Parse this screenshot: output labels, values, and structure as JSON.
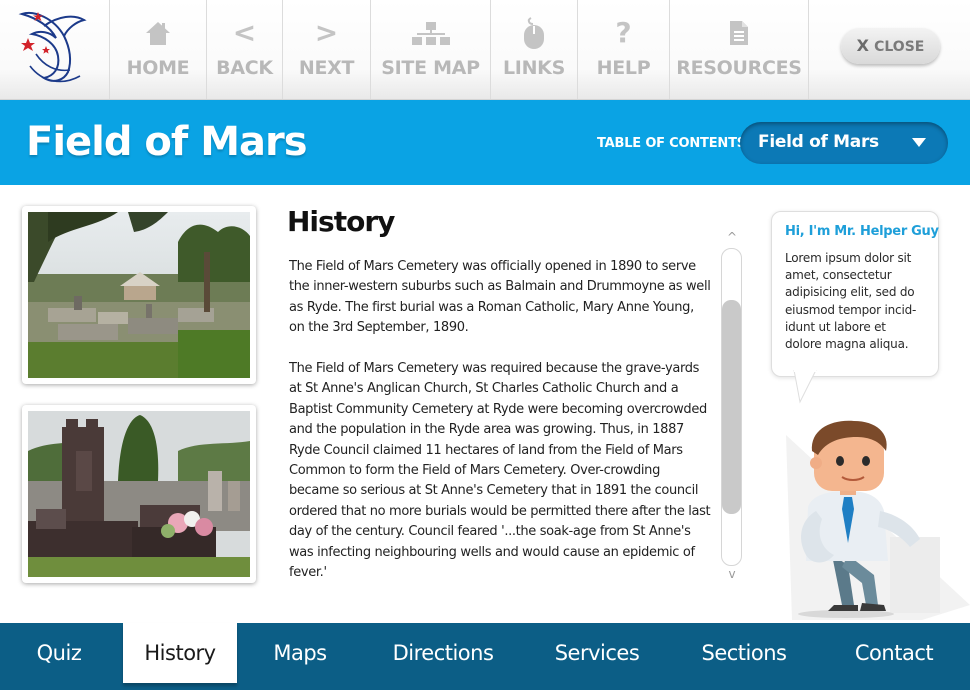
{
  "toolbar": {
    "home": {
      "label": "HOME",
      "icon": "home-icon"
    },
    "back": {
      "label": "BACK",
      "icon": "chevron-left-icon",
      "glyph": "<"
    },
    "next": {
      "label": "NEXT",
      "icon": "chevron-right-icon",
      "glyph": ">"
    },
    "sitemap": {
      "label": "SITE MAP",
      "icon": "sitemap-icon"
    },
    "links": {
      "label": "LINKS",
      "icon": "mouse-icon"
    },
    "help": {
      "label": "HELP",
      "icon": "question-icon",
      "glyph": "?"
    },
    "resources": {
      "label": "RESOURCES",
      "icon": "document-icon"
    },
    "close": {
      "x": "X",
      "label": "CLOSE"
    }
  },
  "header": {
    "title": "Field of Mars",
    "toc_label": "TABLE OF CONTENTS",
    "toc_selected": "Field of Mars"
  },
  "article": {
    "heading": "History",
    "paragraphs": [
      "The Field of Mars Cemetery was officially opened in 1890 to serve the inner-western suburbs such as Balmain and Drummoyne as well as Ryde. The first burial was a Roman Catholic, Mary Anne Young, on the 3rd September, 1890.",
      "The Field of Mars Cemetery was required because the grave-yards at St Anne's Anglican Church, St Charles Catholic Church and a Baptist Community Cemetery at Ryde were becoming overcrowded and the population in the Ryde area was growing. Thus, in 1887 Ryde Council claimed 11 hectares of land from the Field of Mars Common to form the Field of Mars Cemetery. Over-crowding became so serious at St Anne's Cemetery that in 1891 the council ordered that no more burials would be permitted there after the last day of the century. Council feared '...the soak-age from St Anne's was infecting neighbouring wells and would cause an epidemic of fever.'"
    ]
  },
  "scrollbar": {
    "up": "^",
    "down": "v"
  },
  "helper": {
    "title": "Hi, I'm Mr. Helper Guy",
    "text": "Lorem ipsum dolor sit amet, consectetur adipisicing elit, sed do eiusmod tempor incid-idunt ut labore et dolore magna aliqua."
  },
  "tabs": [
    {
      "label": "Quiz",
      "active": false
    },
    {
      "label": "History",
      "active": true
    },
    {
      "label": "Maps",
      "active": false
    },
    {
      "label": "Directions",
      "active": false
    },
    {
      "label": "Services",
      "active": false
    },
    {
      "label": "Sections",
      "active": false
    },
    {
      "label": "Contact",
      "active": false
    }
  ],
  "colors": {
    "brand_blue": "#0aa3e4",
    "toc_dark_blue": "#0c79b6",
    "tabbar_blue": "#0c5e86",
    "nav_grey": "#b8b8b8",
    "helper_title": "#1e9fd9"
  }
}
